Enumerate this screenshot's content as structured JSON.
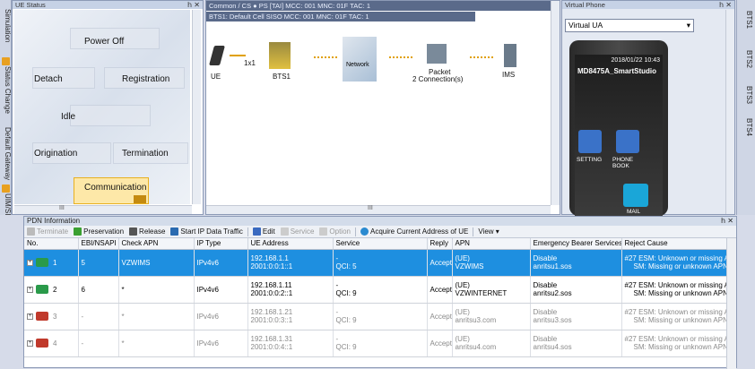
{
  "left_tabs": [
    "Simulation",
    "Status Change",
    "Default Gateway",
    "UIM/SIM"
  ],
  "ue_status": {
    "title": "UE Status",
    "pin": "հ ✕",
    "states": {
      "power_off": "Power Off",
      "detach": "Detach",
      "registration": "Registration",
      "idle": "Idle",
      "origination": "Origination",
      "termination": "Termination",
      "communication": "Communication"
    },
    "scroll_mark": "III"
  },
  "network": {
    "info_line1": "Common  /  CS  ● PS  [TAI] MCC: 001  MNC: 01F  TAC: 1",
    "info_line2": "BTS1: Default Cell SISO   MCC: 001   MNC: 01F   TAC: 1",
    "link_label": "1x1",
    "nodes": {
      "ue": "UE",
      "bts": "BTS1",
      "network": "Network",
      "packet": "Packet",
      "packet_sub": "2 Connection(s)",
      "ims": "IMS"
    },
    "scroll_mark": "III"
  },
  "virtual_phone": {
    "title": "Virtual Phone",
    "pin": "հ ✕",
    "selected": "Virtual UA",
    "status_time": "2018/01/22 10:43",
    "device_name": "MD8475A_SmartStudio",
    "apps": {
      "setting": "SETTING",
      "phone_book": "PHONE BOOK",
      "mail": "MAIL"
    }
  },
  "right_tabs": [
    "BTS1",
    "BTS2",
    "BTS3",
    "BTS4"
  ],
  "pdn": {
    "title": "PDN Information",
    "pin": "հ ✕",
    "toolbar": {
      "terminate": "Terminate",
      "preservation": "Preservation",
      "release": "Release",
      "start_ip": "Start IP Data Traffic",
      "edit": "Edit",
      "service": "Service",
      "option": "Option",
      "acquire": "Acquire Current Address of UE",
      "view": "View ▾"
    },
    "columns": [
      "No.",
      "EBI/NSAPI",
      "Check APN",
      "IP Type",
      "UE Address",
      "Service",
      "Reply",
      "APN",
      "Emergency Bearer Services",
      "Reject Cause"
    ],
    "rows": [
      {
        "no": "1",
        "ebi": "5",
        "check_apn": "VZWIMS",
        "ip_type": "IPv4v6",
        "addr1": "192.168.1.1",
        "addr2": "2001:0:0:1::1",
        "svc1": "-",
        "svc2": "QCI: 5",
        "reply": "Accept",
        "apn1": "(UE)",
        "apn2": "VZWIMS",
        "ebs1": "Disable",
        "ebs2": "anritsu1.sos",
        "rej1": "#27 ESM: Unknown or missing APN",
        "rej2": "SM: Missing or unknown APN"
      },
      {
        "no": "2",
        "ebi": "6",
        "check_apn": "*",
        "ip_type": "IPv4v6",
        "addr1": "192.168.1.11",
        "addr2": "2001:0:0:2::1",
        "svc1": "-",
        "svc2": "QCI: 9",
        "reply": "Accept",
        "apn1": "(UE)",
        "apn2": "VZWINTERNET",
        "ebs1": "Disable",
        "ebs2": "anritsu2.sos",
        "rej1": "#27 ESM: Unknown or missing APN",
        "rej2": "SM: Missing or unknown APN"
      },
      {
        "no": "3",
        "ebi": "-",
        "check_apn": "*",
        "ip_type": "IPv4v6",
        "addr1": "192.168.1.21",
        "addr2": "2001:0:0:3::1",
        "svc1": "-",
        "svc2": "QCI: 9",
        "reply": "Accept",
        "apn1": "(UE)",
        "apn2": "anritsu3.com",
        "ebs1": "Disable",
        "ebs2": "anritsu3.sos",
        "rej1": "#27 ESM: Unknown or missing APN",
        "rej2": "SM: Missing or unknown APN"
      },
      {
        "no": "4",
        "ebi": "-",
        "check_apn": "*",
        "ip_type": "IPv4v6",
        "addr1": "192.168.1.31",
        "addr2": "2001:0:0:4::1",
        "svc1": "-",
        "svc2": "QCI: 9",
        "reply": "Accept",
        "apn1": "(UE)",
        "apn2": "anritsu4.com",
        "ebs1": "Disable",
        "ebs2": "anritsu4.sos",
        "rej1": "#27 ESM: Unknown or missing APN",
        "rej2": "SM: Missing or unknown APN"
      }
    ]
  },
  "colors": {
    "selected_row": "#1e8fe0",
    "communication_highlight": "#fde8a8",
    "panel_border": "#8c9ab6"
  }
}
